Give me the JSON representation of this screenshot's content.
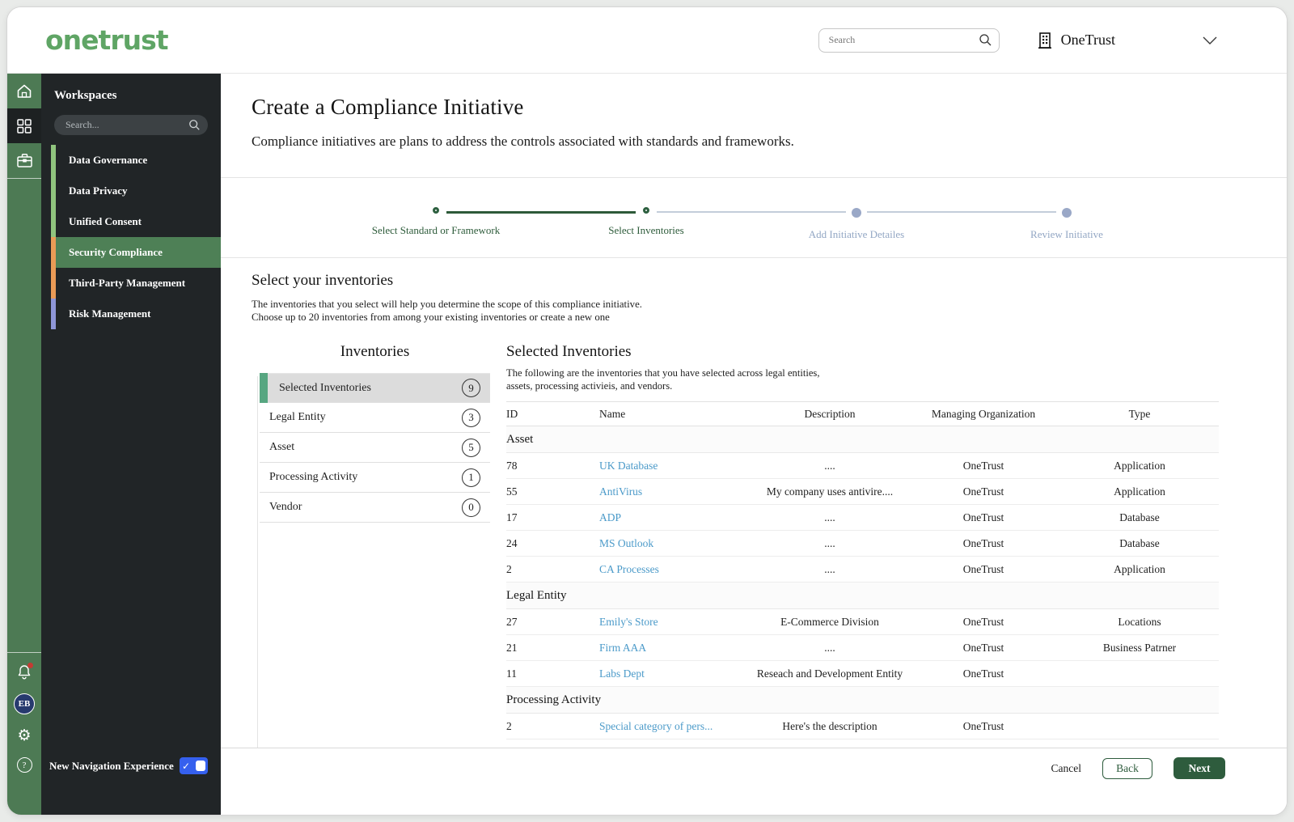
{
  "header": {
    "logo": "onetrust",
    "search_placeholder": "Search",
    "org_name": "OneTrust"
  },
  "sidebar": {
    "workspaces_title": "Workspaces",
    "search_placeholder": "Search...",
    "items": [
      {
        "label": "Data Governance",
        "accent": "#90c47e",
        "selected": false
      },
      {
        "label": "Data Privacy",
        "accent": "#90c47e",
        "selected": false
      },
      {
        "label": "Unified Consent",
        "accent": "#90c47e",
        "selected": false
      },
      {
        "label": "Security Compliance",
        "accent": "#ea9b56",
        "selected": true
      },
      {
        "label": "Third-Party Management",
        "accent": "#ea9b56",
        "selected": false
      },
      {
        "label": "Risk Management",
        "accent": "#8e96d8",
        "selected": false
      }
    ],
    "avatar_initials": "EB",
    "new_nav_label": "New Navigation Experience"
  },
  "page": {
    "title": "Create a Compliance Initiative",
    "subtitle": "Compliance initiatives are plans to address the controls associated with standards and frameworks."
  },
  "stepper": {
    "steps": [
      {
        "label": "Select Standard or Framework",
        "state": "done"
      },
      {
        "label": "Select Inventories",
        "state": "current"
      },
      {
        "label": "Add Initiative Detailes",
        "state": "upcoming"
      },
      {
        "label": "Review Initiative",
        "state": "upcoming"
      }
    ]
  },
  "section": {
    "heading": "Select your inventories",
    "line1": "The inventories that you select will help you determine the scope of this compliance initiative.",
    "line2": "Choose up to 20 inventories from among your existing inventories or create a new one"
  },
  "inventories_panel": {
    "title": "Inventories",
    "categories": [
      {
        "label": "Selected Inventories",
        "count": "9",
        "selected": true
      },
      {
        "label": "Legal Entity",
        "count": "3",
        "selected": false
      },
      {
        "label": "Asset",
        "count": "5",
        "selected": false
      },
      {
        "label": "Processing Activity",
        "count": "1",
        "selected": false
      },
      {
        "label": "Vendor",
        "count": "0",
        "selected": false
      }
    ]
  },
  "selected_panel": {
    "title": "Selected Inventories",
    "desc_line1": "The following are the inventories that you have selected across legal entities,",
    "desc_line2": "assets, processing activieis, and vendors.",
    "columns": [
      "ID",
      "Name",
      "Description",
      "Managing Organization",
      "Type"
    ],
    "groups": [
      {
        "name": "Asset",
        "rows": [
          {
            "id": "78",
            "name": "UK Database",
            "description": "....",
            "org": "OneTrust",
            "type": "Application"
          },
          {
            "id": "55",
            "name": "AntiVirus",
            "description": "My company uses antivire....",
            "org": "OneTrust",
            "type": "Application"
          },
          {
            "id": "17",
            "name": "ADP",
            "description": "....",
            "org": "OneTrust",
            "type": "Database"
          },
          {
            "id": "24",
            "name": "MS Outlook",
            "description": "....",
            "org": "OneTrust",
            "type": "Database"
          },
          {
            "id": "2",
            "name": "CA Processes",
            "description": "....",
            "org": "OneTrust",
            "type": "Application"
          }
        ]
      },
      {
        "name": "Legal Entity",
        "rows": [
          {
            "id": "27",
            "name": "Emily's Store",
            "description": "E-Commerce Division",
            "org": "OneTrust",
            "type": "Locations"
          },
          {
            "id": "21",
            "name": "Firm AAA",
            "description": "....",
            "org": "OneTrust",
            "type": "Business Patrner"
          },
          {
            "id": "11",
            "name": "Labs Dept",
            "description": "Reseach and Development Entity",
            "org": "OneTrust",
            "type": ""
          }
        ]
      },
      {
        "name": "Processing Activity",
        "rows": [
          {
            "id": "2",
            "name": "Special category of pers...",
            "description": "Here's the description",
            "org": "OneTrust",
            "type": ""
          }
        ]
      }
    ]
  },
  "footer": {
    "cancel": "Cancel",
    "back": "Back",
    "next": "Next"
  },
  "colors": {
    "brand_green": "#5fa565",
    "rail_green": "#4d7a54",
    "panel_dark": "#212527",
    "selected_workspace_green": "#4e8056",
    "selected_inventory_accent": "#57a681",
    "stepper_done_green": "#2d5a39",
    "stepper_upcoming_gray": "#9aa8c7",
    "link_blue": "#4b9ac9",
    "toggle_blue": "#3560ee",
    "button_green": "#2e5c3d",
    "avatar_navy": "#273a6e",
    "notification_red": "#c43b33"
  }
}
